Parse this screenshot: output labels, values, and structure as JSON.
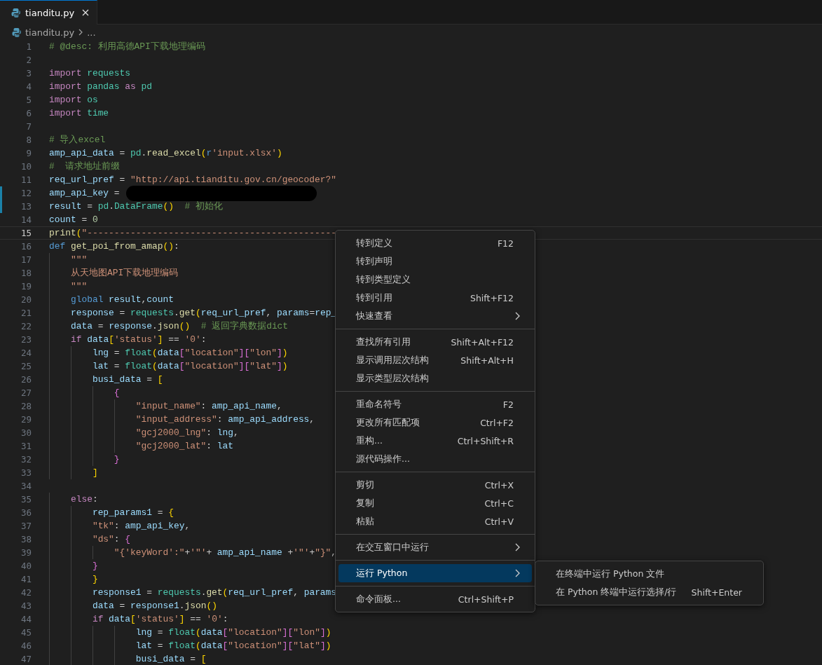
{
  "tabs": [
    {
      "label": "tianditu.py",
      "selected": true
    }
  ],
  "breadcrumb": {
    "file": "tianditu.py",
    "more": "..."
  },
  "editor": {
    "lines": [
      {
        "number": "1",
        "tokens": [
          {
            "kind": "comment",
            "text": "# @desc: 利用高德API下载地理编码"
          }
        ]
      },
      {
        "number": "2"
      },
      {
        "number": "3",
        "tokens": [
          {
            "kind": "keyword",
            "text": "import "
          },
          {
            "kind": "module",
            "text": "requests"
          }
        ]
      },
      {
        "number": "4",
        "tokens": [
          {
            "kind": "keyword",
            "text": "import "
          },
          {
            "kind": "module",
            "text": "pandas "
          },
          {
            "kind": "keyword",
            "text": "as "
          },
          {
            "kind": "module",
            "text": "pd"
          }
        ]
      },
      {
        "number": "5",
        "tokens": [
          {
            "kind": "keyword",
            "text": "import "
          },
          {
            "kind": "module",
            "text": "os"
          }
        ]
      },
      {
        "number": "6",
        "tokens": [
          {
            "kind": "keyword",
            "text": "import "
          },
          {
            "kind": "module",
            "text": "time"
          }
        ]
      },
      {
        "number": "7"
      },
      {
        "number": "8",
        "tokens": [
          {
            "kind": "comment",
            "text": "# 导入excel"
          }
        ]
      },
      {
        "number": "9",
        "tokens": [
          {
            "kind": "variable",
            "text": "amp_api_data"
          },
          {
            "kind": "plain",
            "text": " = "
          },
          {
            "kind": "module",
            "text": "pd"
          },
          {
            "kind": "plain",
            "text": "."
          },
          {
            "kind": "function",
            "text": "read_excel"
          },
          {
            "kind": "bracket1",
            "text": "("
          },
          {
            "kind": "storage",
            "text": "r"
          },
          {
            "kind": "string",
            "text": "'input.xlsx'"
          },
          {
            "kind": "bracket1",
            "text": ")"
          }
        ]
      },
      {
        "number": "10",
        "tokens": [
          {
            "kind": "comment",
            "text": "#  请求地址前缀"
          }
        ]
      },
      {
        "number": "11",
        "tokens": [
          {
            "kind": "variable",
            "text": "req_url_pref"
          },
          {
            "kind": "plain",
            "text": " = "
          },
          {
            "kind": "string",
            "text": "\"http://api.tianditu.gov.cn/geocoder?\""
          }
        ]
      },
      {
        "number": "12",
        "redacted": true,
        "changed": true,
        "tokens": [
          {
            "kind": "variable",
            "text": "amp_api_key"
          },
          {
            "kind": "plain",
            "text": " = "
          }
        ]
      },
      {
        "number": "13",
        "changed": true,
        "tokens": [
          {
            "kind": "variable",
            "text": "result"
          },
          {
            "kind": "plain",
            "text": " = "
          },
          {
            "kind": "module",
            "text": "pd"
          },
          {
            "kind": "plain",
            "text": "."
          },
          {
            "kind": "class",
            "text": "DataFrame"
          },
          {
            "kind": "bracket1",
            "text": "()"
          },
          {
            "kind": "comment",
            "text": "  # 初始化"
          }
        ]
      },
      {
        "number": "14",
        "tokens": [
          {
            "kind": "variable",
            "text": "count"
          },
          {
            "kind": "plain",
            "text": " = "
          },
          {
            "kind": "number",
            "text": "0"
          }
        ]
      },
      {
        "number": "15",
        "current": true,
        "tokens": [
          {
            "kind": "function",
            "text": "print"
          },
          {
            "kind": "bracket1",
            "text": "("
          },
          {
            "kind": "string",
            "text": "\"----------------------------------------------"
          }
        ]
      },
      {
        "number": "16",
        "tokens": [
          {
            "kind": "storage",
            "text": "def "
          },
          {
            "kind": "function",
            "text": "get_poi_from_amap"
          },
          {
            "kind": "bracket1",
            "text": "()"
          },
          {
            "kind": "plain",
            "text": ":"
          }
        ]
      },
      {
        "number": "17",
        "tokens": [
          {
            "kind": "string",
            "text": "    \"\"\""
          }
        ]
      },
      {
        "number": "18",
        "tokens": [
          {
            "kind": "string",
            "text": "    从天地图API下载地理编码"
          }
        ]
      },
      {
        "number": "19",
        "tokens": [
          {
            "kind": "string",
            "text": "    \"\"\""
          }
        ]
      },
      {
        "number": "20",
        "tokens": [
          {
            "kind": "storage",
            "text": "    global "
          },
          {
            "kind": "variable",
            "text": "result"
          },
          {
            "kind": "plain",
            "text": ","
          },
          {
            "kind": "variable",
            "text": "count"
          }
        ]
      },
      {
        "number": "21",
        "tokens": [
          {
            "kind": "variable",
            "text": "    response"
          },
          {
            "kind": "plain",
            "text": " = "
          },
          {
            "kind": "module",
            "text": "requests"
          },
          {
            "kind": "plain",
            "text": "."
          },
          {
            "kind": "function",
            "text": "get"
          },
          {
            "kind": "bracket1",
            "text": "("
          },
          {
            "kind": "variable",
            "text": "req_url_pref"
          },
          {
            "kind": "plain",
            "text": ", "
          },
          {
            "kind": "variable",
            "text": "params"
          },
          {
            "kind": "plain",
            "text": "="
          },
          {
            "kind": "variable",
            "text": "rep_"
          }
        ]
      },
      {
        "number": "22",
        "tokens": [
          {
            "kind": "variable",
            "text": "    data"
          },
          {
            "kind": "plain",
            "text": " = "
          },
          {
            "kind": "variable",
            "text": "response"
          },
          {
            "kind": "plain",
            "text": "."
          },
          {
            "kind": "function",
            "text": "json"
          },
          {
            "kind": "bracket1",
            "text": "()"
          },
          {
            "kind": "comment",
            "text": "  # 返回字典数据dict"
          }
        ]
      },
      {
        "number": "23",
        "tokens": [
          {
            "kind": "keyword",
            "text": "    if "
          },
          {
            "kind": "variable",
            "text": "data"
          },
          {
            "kind": "bracket1",
            "text": "["
          },
          {
            "kind": "string",
            "text": "'status'"
          },
          {
            "kind": "bracket1",
            "text": "]"
          },
          {
            "kind": "plain",
            "text": " == "
          },
          {
            "kind": "string",
            "text": "'0'"
          },
          {
            "kind": "plain",
            "text": ":"
          }
        ]
      },
      {
        "number": "24",
        "tokens": [
          {
            "kind": "variable",
            "text": "        lng"
          },
          {
            "kind": "plain",
            "text": " = "
          },
          {
            "kind": "class",
            "text": "float"
          },
          {
            "kind": "bracket1",
            "text": "("
          },
          {
            "kind": "variable",
            "text": "data"
          },
          {
            "kind": "bracket2",
            "text": "["
          },
          {
            "kind": "string",
            "text": "\"location\""
          },
          {
            "kind": "bracket2",
            "text": "]["
          },
          {
            "kind": "string",
            "text": "\"lon\""
          },
          {
            "kind": "bracket2",
            "text": "]"
          },
          {
            "kind": "bracket1",
            "text": ")"
          }
        ]
      },
      {
        "number": "25",
        "tokens": [
          {
            "kind": "variable",
            "text": "        lat"
          },
          {
            "kind": "plain",
            "text": " = "
          },
          {
            "kind": "class",
            "text": "float"
          },
          {
            "kind": "bracket1",
            "text": "("
          },
          {
            "kind": "variable",
            "text": "data"
          },
          {
            "kind": "bracket2",
            "text": "["
          },
          {
            "kind": "string",
            "text": "\"location\""
          },
          {
            "kind": "bracket2",
            "text": "]["
          },
          {
            "kind": "string",
            "text": "\"lat\""
          },
          {
            "kind": "bracket2",
            "text": "]"
          },
          {
            "kind": "bracket1",
            "text": ")"
          }
        ]
      },
      {
        "number": "26",
        "tokens": [
          {
            "kind": "variable",
            "text": "        busi_data"
          },
          {
            "kind": "plain",
            "text": " = "
          },
          {
            "kind": "bracket1",
            "text": "["
          }
        ]
      },
      {
        "number": "27",
        "tokens": [
          {
            "kind": "bracket2",
            "text": "            {"
          }
        ]
      },
      {
        "number": "28",
        "tokens": [
          {
            "kind": "string",
            "text": "                \"input_name\""
          },
          {
            "kind": "plain",
            "text": ": "
          },
          {
            "kind": "variable",
            "text": "amp_api_name"
          },
          {
            "kind": "plain",
            "text": ","
          }
        ]
      },
      {
        "number": "29",
        "tokens": [
          {
            "kind": "string",
            "text": "                \"input_address\""
          },
          {
            "kind": "plain",
            "text": ": "
          },
          {
            "kind": "variable",
            "text": "amp_api_address"
          },
          {
            "kind": "plain",
            "text": ","
          }
        ]
      },
      {
        "number": "30",
        "tokens": [
          {
            "kind": "string",
            "text": "                \"gcj2000_lng\""
          },
          {
            "kind": "plain",
            "text": ": "
          },
          {
            "kind": "variable",
            "text": "lng"
          },
          {
            "kind": "plain",
            "text": ","
          }
        ]
      },
      {
        "number": "31",
        "tokens": [
          {
            "kind": "string",
            "text": "                \"gcj2000_lat\""
          },
          {
            "kind": "plain",
            "text": ": "
          },
          {
            "kind": "variable",
            "text": "lat"
          }
        ]
      },
      {
        "number": "32",
        "tokens": [
          {
            "kind": "bracket2",
            "text": "            }"
          }
        ]
      },
      {
        "number": "33",
        "tokens": [
          {
            "kind": "bracket1",
            "text": "        ]"
          }
        ]
      },
      {
        "number": "34"
      },
      {
        "number": "35",
        "tokens": [
          {
            "kind": "keyword",
            "text": "    else"
          },
          {
            "kind": "plain",
            "text": ":"
          }
        ]
      },
      {
        "number": "36",
        "tokens": [
          {
            "kind": "variable",
            "text": "        rep_params1"
          },
          {
            "kind": "plain",
            "text": " = "
          },
          {
            "kind": "bracket1",
            "text": "{"
          }
        ]
      },
      {
        "number": "37",
        "tokens": [
          {
            "kind": "string",
            "text": "        \"tk\""
          },
          {
            "kind": "plain",
            "text": ": "
          },
          {
            "kind": "variable",
            "text": "amp_api_key"
          },
          {
            "kind": "plain",
            "text": ","
          }
        ]
      },
      {
        "number": "38",
        "tokens": [
          {
            "kind": "string",
            "text": "        \"ds\""
          },
          {
            "kind": "plain",
            "text": ": "
          },
          {
            "kind": "bracket2",
            "text": "{"
          }
        ]
      },
      {
        "number": "39",
        "tokens": [
          {
            "kind": "string",
            "text": "            \"{'keyWord':\""
          },
          {
            "kind": "plain",
            "text": "+"
          },
          {
            "kind": "string",
            "text": "'\"'"
          },
          {
            "kind": "plain",
            "text": "+ "
          },
          {
            "kind": "variable",
            "text": "amp_api_name"
          },
          {
            "kind": "plain",
            "text": " +"
          },
          {
            "kind": "string",
            "text": "'\"'"
          },
          {
            "kind": "plain",
            "text": "+"
          },
          {
            "kind": "string",
            "text": "\"}\""
          },
          {
            "kind": "plain",
            "text": ","
          }
        ]
      },
      {
        "number": "40",
        "tokens": [
          {
            "kind": "bracket2",
            "text": "        }"
          }
        ]
      },
      {
        "number": "41",
        "tokens": [
          {
            "kind": "bracket1",
            "text": "        }"
          }
        ]
      },
      {
        "number": "42",
        "tokens": [
          {
            "kind": "variable",
            "text": "        response1"
          },
          {
            "kind": "plain",
            "text": " = "
          },
          {
            "kind": "module",
            "text": "requests"
          },
          {
            "kind": "plain",
            "text": "."
          },
          {
            "kind": "function",
            "text": "get"
          },
          {
            "kind": "bracket1",
            "text": "("
          },
          {
            "kind": "variable",
            "text": "req_url_pref"
          },
          {
            "kind": "plain",
            "text": ", "
          },
          {
            "kind": "variable",
            "text": "params"
          }
        ]
      },
      {
        "number": "43",
        "tokens": [
          {
            "kind": "variable",
            "text": "        data"
          },
          {
            "kind": "plain",
            "text": " = "
          },
          {
            "kind": "variable",
            "text": "response1"
          },
          {
            "kind": "plain",
            "text": "."
          },
          {
            "kind": "function",
            "text": "json"
          },
          {
            "kind": "bracket1",
            "text": "()"
          }
        ]
      },
      {
        "number": "44",
        "tokens": [
          {
            "kind": "keyword",
            "text": "        if "
          },
          {
            "kind": "variable",
            "text": "data"
          },
          {
            "kind": "bracket1",
            "text": "["
          },
          {
            "kind": "string",
            "text": "'status'"
          },
          {
            "kind": "bracket1",
            "text": "]"
          },
          {
            "kind": "plain",
            "text": " == "
          },
          {
            "kind": "string",
            "text": "'0'"
          },
          {
            "kind": "plain",
            "text": ":"
          }
        ]
      },
      {
        "number": "45",
        "tokens": [
          {
            "kind": "variable",
            "text": "                lng"
          },
          {
            "kind": "plain",
            "text": " = "
          },
          {
            "kind": "class",
            "text": "float"
          },
          {
            "kind": "bracket1",
            "text": "("
          },
          {
            "kind": "variable",
            "text": "data"
          },
          {
            "kind": "bracket2",
            "text": "["
          },
          {
            "kind": "string",
            "text": "\"location\""
          },
          {
            "kind": "bracket2",
            "text": "]["
          },
          {
            "kind": "string",
            "text": "\"lon\""
          },
          {
            "kind": "bracket2",
            "text": "]"
          },
          {
            "kind": "bracket1",
            "text": ")"
          }
        ]
      },
      {
        "number": "46",
        "tokens": [
          {
            "kind": "variable",
            "text": "                lat"
          },
          {
            "kind": "plain",
            "text": " = "
          },
          {
            "kind": "class",
            "text": "float"
          },
          {
            "kind": "bracket1",
            "text": "("
          },
          {
            "kind": "variable",
            "text": "data"
          },
          {
            "kind": "bracket2",
            "text": "["
          },
          {
            "kind": "string",
            "text": "\"location\""
          },
          {
            "kind": "bracket2",
            "text": "]["
          },
          {
            "kind": "string",
            "text": "\"lat\""
          },
          {
            "kind": "bracket2",
            "text": "]"
          },
          {
            "kind": "bracket1",
            "text": ")"
          }
        ]
      },
      {
        "number": "47",
        "tokens": [
          {
            "kind": "variable",
            "text": "                busi_data"
          },
          {
            "kind": "plain",
            "text": " = "
          },
          {
            "kind": "bracket1",
            "text": "["
          }
        ]
      }
    ]
  },
  "context_menu": {
    "groups": [
      [
        {
          "label": "转到定义",
          "shortcut": "F12",
          "submenu": false,
          "selected": false
        },
        {
          "label": "转到声明",
          "submenu": false,
          "selected": false
        },
        {
          "label": "转到类型定义",
          "submenu": false,
          "selected": false
        },
        {
          "label": "转到引用",
          "shortcut": "Shift+F12",
          "submenu": false,
          "selected": false
        },
        {
          "label": "快速查看",
          "submenu": true,
          "selected": false
        }
      ],
      [
        {
          "label": "查找所有引用",
          "shortcut": "Shift+Alt+F12",
          "submenu": false,
          "selected": false
        },
        {
          "label": "显示调用层次结构",
          "shortcut": "Shift+Alt+H",
          "submenu": false,
          "selected": false
        },
        {
          "label": "显示类型层次结构",
          "submenu": false,
          "selected": false
        }
      ],
      [
        {
          "label": "重命名符号",
          "shortcut": "F2",
          "submenu": false,
          "selected": false
        },
        {
          "label": "更改所有匹配项",
          "shortcut": "Ctrl+F2",
          "submenu": false,
          "selected": false
        },
        {
          "label": "重构...",
          "shortcut": "Ctrl+Shift+R",
          "submenu": false,
          "selected": false
        },
        {
          "label": "源代码操作...",
          "submenu": false,
          "selected": false
        }
      ],
      [
        {
          "label": "剪切",
          "shortcut": "Ctrl+X",
          "submenu": false,
          "selected": false
        },
        {
          "label": "复制",
          "shortcut": "Ctrl+C",
          "submenu": false,
          "selected": false
        },
        {
          "label": "粘贴",
          "shortcut": "Ctrl+V",
          "submenu": false,
          "selected": false
        }
      ],
      [
        {
          "label": "在交互窗口中运行",
          "submenu": true,
          "selected": false
        }
      ],
      [
        {
          "label": "运行 Python",
          "submenu": true,
          "selected": true
        }
      ],
      [
        {
          "label": "命令面板...",
          "shortcut": "Ctrl+Shift+P",
          "submenu": false,
          "selected": false
        }
      ]
    ]
  },
  "submenu": {
    "items": [
      {
        "label": "在终端中运行 Python 文件",
        "selected": false
      },
      {
        "label": "在 Python 终端中运行选择/行",
        "shortcut": "Shift+Enter",
        "selected": false
      }
    ]
  }
}
